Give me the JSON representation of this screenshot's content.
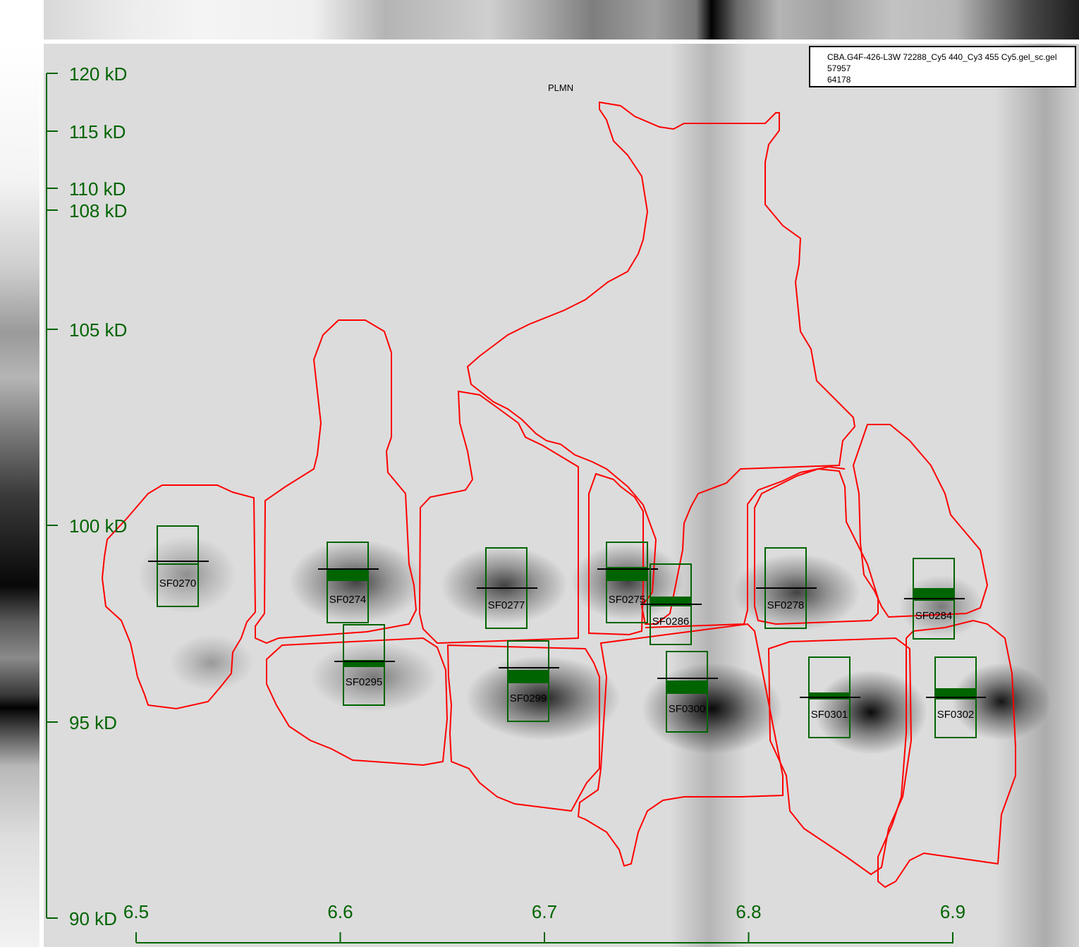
{
  "legend": {
    "line1": "CBA.G4F-426-L3W 72288_Cy5 440_Cy3 455 Cy5.gel_sc.gel",
    "line2": "57957",
    "line3": "64178"
  },
  "protein_label": "PLMN",
  "y_axis": {
    "ticks": [
      {
        "label": "120 kD",
        "value": 120
      },
      {
        "label": "115 kD",
        "value": 115
      },
      {
        "label": "110 kD",
        "value": 110
      },
      {
        "label": "108 kD",
        "value": 108
      },
      {
        "label": "105 kD",
        "value": 105
      },
      {
        "label": "100 kD",
        "value": 100
      },
      {
        "label": "95 kD",
        "value": 95
      },
      {
        "label": "90 kD",
        "value": 90
      }
    ]
  },
  "x_axis": {
    "ticks": [
      {
        "label": "6.5",
        "value": 6.5
      },
      {
        "label": "6.6",
        "value": 6.6
      },
      {
        "label": "6.7",
        "value": 6.7
      },
      {
        "label": "6.8",
        "value": 6.8
      },
      {
        "label": "6.9",
        "value": 6.9
      }
    ]
  },
  "spots": [
    {
      "id": "SF0270"
    },
    {
      "id": "SF0274"
    },
    {
      "id": "SF0277"
    },
    {
      "id": "SF0275"
    },
    {
      "id": "SF0286"
    },
    {
      "id": "SF0278"
    },
    {
      "id": "SF0284"
    },
    {
      "id": "SF0295"
    },
    {
      "id": "SF0299"
    },
    {
      "id": "SF0300"
    },
    {
      "id": "SF0301"
    },
    {
      "id": "SF0302"
    }
  ],
  "colors": {
    "axis": "#006400",
    "outline": "#ff0000",
    "marker": "#006400"
  }
}
